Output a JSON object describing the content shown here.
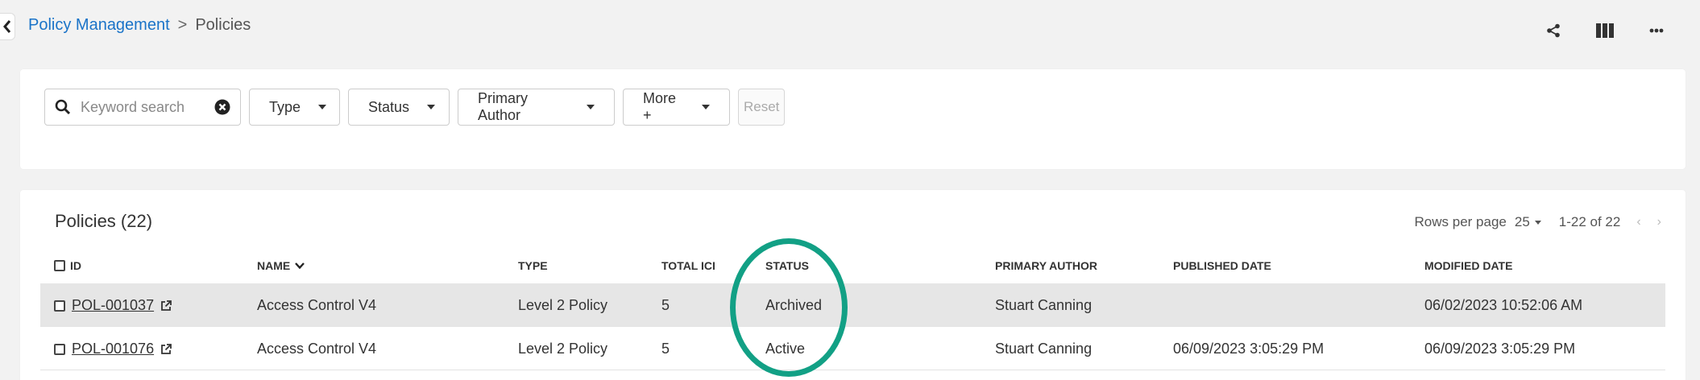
{
  "breadcrumb": {
    "parent": "Policy Management",
    "separator": ">",
    "current": "Policies"
  },
  "filters": {
    "search_placeholder": "Keyword search",
    "type_label": "Type",
    "status_label": "Status",
    "author_label": "Primary Author",
    "more_label": "More +",
    "reset_label": "Reset"
  },
  "table": {
    "title": "Policies (22)",
    "rows_per_page_label": "Rows per page",
    "rows_per_page_value": "25",
    "range": "1-22 of 22",
    "columns": {
      "id": "ID",
      "name": "NAME",
      "type": "TYPE",
      "total_ici": "TOTAL ICI",
      "status": "STATUS",
      "primary_author": "PRIMARY AUTHOR",
      "published_date": "PUBLISHED DATE",
      "modified_date": "MODIFIED DATE"
    },
    "rows": [
      {
        "id": "POL-001037",
        "name": "Access Control V4",
        "type": "Level 2 Policy",
        "total_ici": "5",
        "status": "Archived",
        "primary_author": "Stuart Canning",
        "published_date": "",
        "modified_date": "06/02/2023 10:52:06 AM"
      },
      {
        "id": "POL-001076",
        "name": "Access Control V4",
        "type": "Level 2 Policy",
        "total_ici": "5",
        "status": "Active",
        "primary_author": "Stuart Canning",
        "published_date": "06/09/2023 3:05:29 PM",
        "modified_date": "06/09/2023 3:05:29 PM"
      }
    ]
  },
  "colors": {
    "link": "#1a73c8",
    "highlight": "#12a085",
    "selected_row": "#e6e6e6"
  },
  "icons": [
    "back-chevron-icon",
    "share-icon",
    "columns-icon",
    "more-horizontal-icon",
    "search-icon",
    "clear-icon",
    "external-link-icon",
    "sort-desc-icon"
  ]
}
